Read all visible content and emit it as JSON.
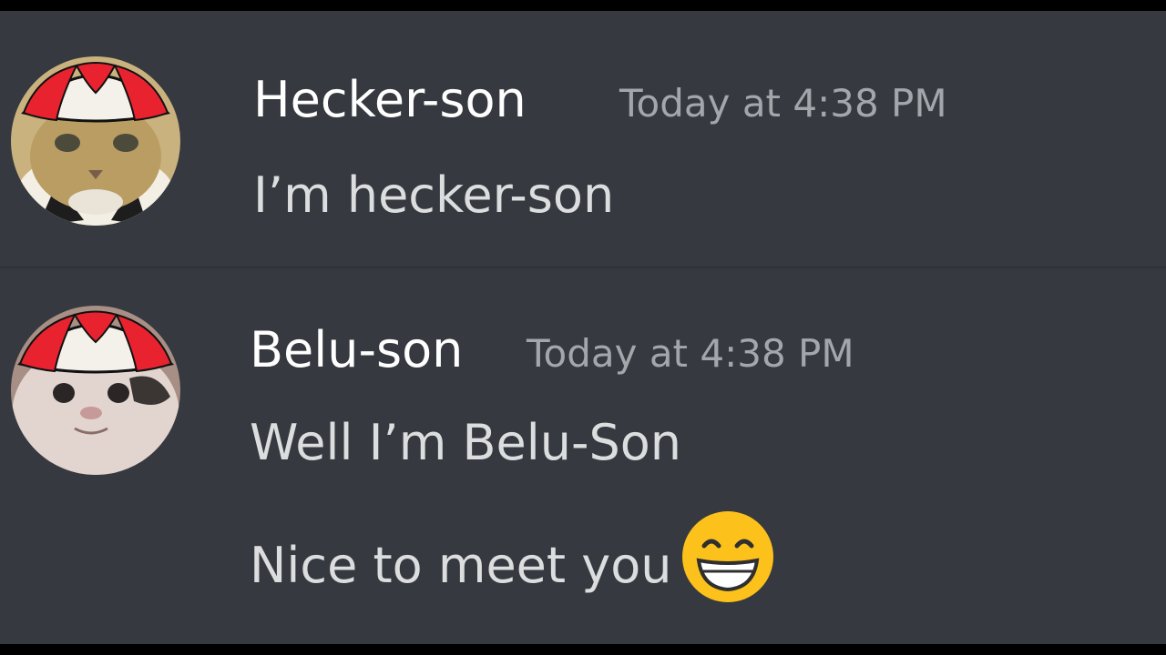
{
  "messages": [
    {
      "username": "Hecker-son",
      "timestamp": "Today at 4:38 PM",
      "lines": [
        "I’m hecker-son"
      ],
      "avatar_icon": "cat-with-propeller-cap-avatar"
    },
    {
      "username": "Belu-son",
      "timestamp": "Today at 4:38 PM",
      "lines": [
        "Well I’m Belu-Son",
        "Nice to meet you"
      ],
      "avatar_icon": "belugacat-with-propeller-cap-avatar",
      "emoji": "grinning-face-with-smiling-eyes"
    }
  ],
  "colors": {
    "background": "#36393f",
    "username": "#ffffff",
    "timestamp": "#a3a6aa",
    "message_text": "#dcddde",
    "cap_red": "#e8232f",
    "cap_white": "#f4f1ea",
    "emoji_yellow": "#fcc21b"
  }
}
